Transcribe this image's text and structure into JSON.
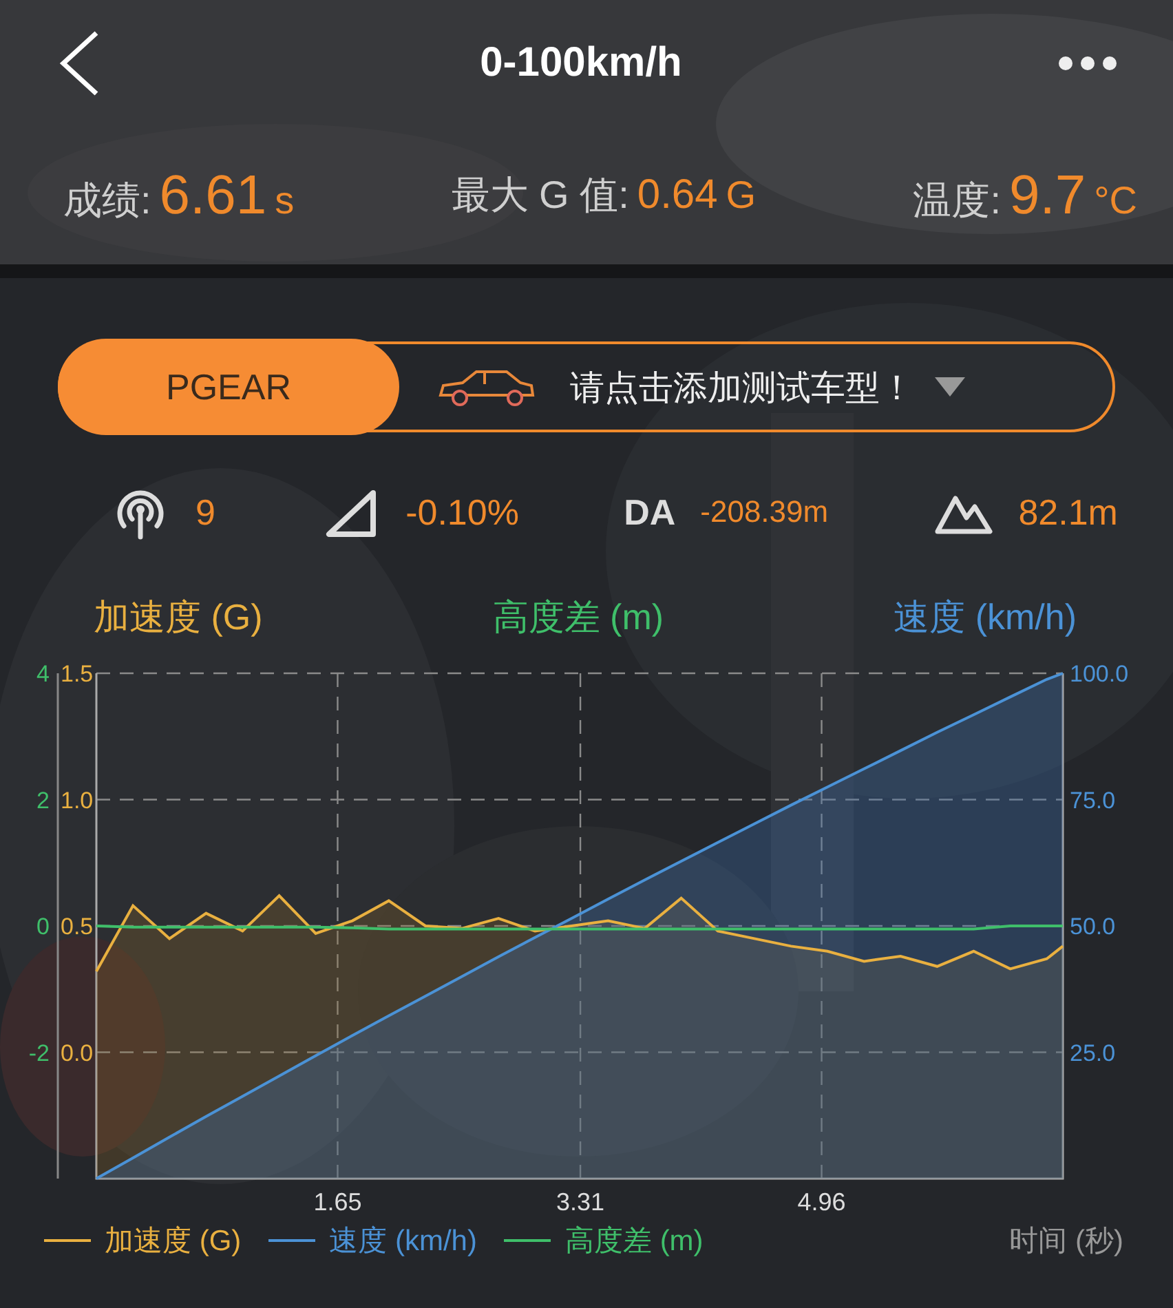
{
  "header": {
    "title": "0-100km/h"
  },
  "stats": [
    {
      "label": "成绩:",
      "value": "6.61",
      "unit": "s",
      "kind": "large"
    },
    {
      "label": "最大 G 值:",
      "value": "0.64",
      "unit": "G",
      "kind": "normal"
    },
    {
      "label": "温度:",
      "value": "9.7",
      "unit": "°C",
      "kind": "large"
    }
  ],
  "vehicle": {
    "mode": "PGEAR",
    "prompt": "请点击添加测试车型！"
  },
  "readings": [
    {
      "kind": "satellites",
      "value": "9"
    },
    {
      "kind": "slope",
      "value": "-0.10%"
    },
    {
      "kind": "density_altitude",
      "label": "DA",
      "value": "-208.39m"
    },
    {
      "kind": "altitude",
      "value": "82.1m"
    }
  ],
  "chart": {
    "axis_titles": [
      {
        "text": "加速度 (G)",
        "color": "#e9b040"
      },
      {
        "text": "高度差 (m)",
        "color": "#3fbf6a"
      },
      {
        "text": "速度 (km/h)",
        "color": "#4b92d6"
      }
    ],
    "chart_data": {
      "type": "line",
      "grid": true,
      "xlabel": "时间 (秒)",
      "xlim": [
        0,
        6.61
      ],
      "xticks": [
        {
          "value": 1.65,
          "label": "1.65"
        },
        {
          "value": 3.31,
          "label": "3.31"
        },
        {
          "value": 4.96,
          "label": "4.96"
        }
      ],
      "ylim": [
        -0.5,
        1.5
      ],
      "yticks": [
        {
          "value": 1.5,
          "label": "1.5"
        },
        {
          "value": 1.0,
          "label": "1.0"
        },
        {
          "value": 0.5,
          "label": "0.5"
        },
        {
          "value": 0.0,
          "label": "0.0"
        }
      ],
      "y2lim": [
        0,
        100
      ],
      "y2ticks": [
        {
          "value": 100,
          "label": "100.0"
        },
        {
          "value": 75,
          "label": "75.0"
        },
        {
          "value": 50,
          "label": "50.0"
        },
        {
          "value": 25,
          "label": "25.0"
        }
      ],
      "y3lim": [
        -4,
        4
      ],
      "y3ticks": [
        {
          "value": 4,
          "label": "4"
        },
        {
          "value": 2,
          "label": "2"
        },
        {
          "value": 0,
          "label": "0"
        },
        {
          "value": -2,
          "label": "-2"
        }
      ],
      "x": [
        0,
        0.25,
        0.5,
        0.75,
        1,
        1.25,
        1.5,
        1.75,
        2,
        2.25,
        2.5,
        2.75,
        3,
        3.25,
        3.5,
        3.75,
        4,
        4.25,
        4.5,
        4.75,
        5,
        5.25,
        5.5,
        5.75,
        6,
        6.25,
        6.5,
        6.61
      ],
      "series": [
        {
          "name": "加速度 (G)",
          "color": "#e9b040",
          "values": [
            0.32,
            0.58,
            0.45,
            0.55,
            0.48,
            0.62,
            0.47,
            0.52,
            0.6,
            0.5,
            0.49,
            0.53,
            0.48,
            0.5,
            0.52,
            0.49,
            0.61,
            0.48,
            0.45,
            0.42,
            0.4,
            0.36,
            0.38,
            0.34,
            0.4,
            0.33,
            0.37,
            0.42
          ]
        },
        {
          "name": "速度 (km/h)",
          "color": "#4b92d6",
          "axis": "y2",
          "values": [
            0,
            4.1,
            8.2,
            12.3,
            16.3,
            20.3,
            24.3,
            28.3,
            32.2,
            36.1,
            40.0,
            43.9,
            47.7,
            51.5,
            55.3,
            59.1,
            62.8,
            66.5,
            70.2,
            73.9,
            77.5,
            81.1,
            84.7,
            88.3,
            91.8,
            95.3,
            98.8,
            100
          ]
        },
        {
          "name": "高度差 (m)",
          "color": "#3fbf6a",
          "axis": "y3",
          "values": [
            0,
            -0.02,
            -0.02,
            -0.02,
            -0.02,
            -0.02,
            -0.02,
            -0.03,
            -0.05,
            -0.05,
            -0.05,
            -0.05,
            -0.05,
            -0.05,
            -0.05,
            -0.05,
            -0.05,
            -0.05,
            -0.05,
            -0.05,
            -0.05,
            -0.05,
            -0.05,
            -0.05,
            -0.05,
            0,
            0,
            0
          ]
        }
      ]
    }
  }
}
